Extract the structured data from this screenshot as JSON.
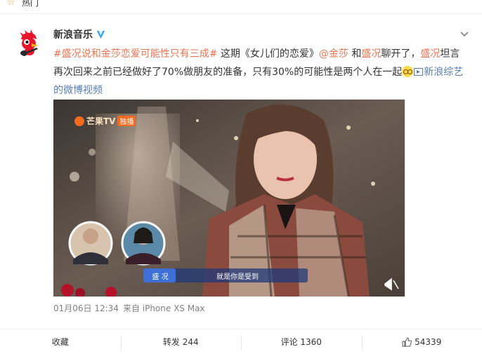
{
  "header": {
    "hot_label": "热门",
    "hot_icon": "star-icon"
  },
  "post": {
    "user_name": "新浪音乐",
    "verified_icon": "verified-v-icon",
    "more_icon": "chevron-down-icon",
    "text": {
      "topic": "#盛况说和金莎恋爱可能性只有三成#",
      "part1": " 这期《女儿们的恋爱》",
      "mention1": "@金莎",
      "part2": " 和",
      "mention2": "盛况",
      "part3": "聊开了，",
      "mention3": "盛况",
      "part4": "坦言再次回来之前已经做好了70%做朋友的准备，只有30%的可能性是两个人在一起",
      "link": "新浪综艺的微博视频"
    },
    "video": {
      "watermark": "芒果TV",
      "exclusive_badge": "独播",
      "caption_name": "盛 况",
      "caption_line": "就是你是受到"
    },
    "meta": {
      "date": "01月06日 12:34",
      "source": "来自 iPhone XS Max"
    },
    "actions": {
      "favorite": "收藏",
      "repost": "转发 244",
      "comment": "评论 1360",
      "like_count": "54339"
    }
  },
  "colors": {
    "topic": "#eb7350",
    "link": "#567db2",
    "verified": "#2aa3ff",
    "hot_star": "#f0a12e"
  }
}
